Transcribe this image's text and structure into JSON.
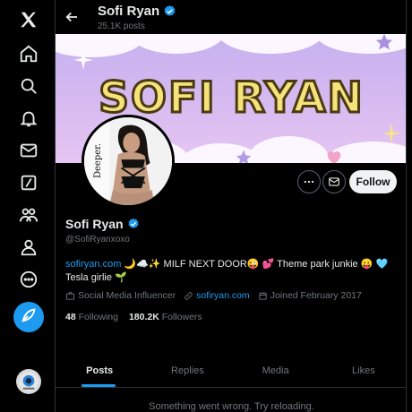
{
  "profile": {
    "name": "Sofi Ryan",
    "post_count": "25.1K posts",
    "handle": "@SofiRyanxoxo",
    "banner_text": "SOFI RYAN",
    "avatar_caption": "Deeper.",
    "bio_link": "sofiryan.com",
    "bio_text": " 🌙☁️✨ MILF NEXT DOOR😜 💕 Theme park junkie 😛 🩵 Tesla girlie 🌱",
    "category": "Social Media Influencer",
    "website": "sofiryan.com",
    "joined": "Joined February 2017",
    "following_count": "48",
    "following_label": "Following",
    "followers_count": "180.2K",
    "followers_label": "Followers"
  },
  "actions": {
    "follow_label": "Follow",
    "more_icon": "more-icon",
    "message_icon": "mail-icon"
  },
  "tabs": [
    {
      "label": "Posts",
      "active": true
    },
    {
      "label": "Replies",
      "active": false
    },
    {
      "label": "Media",
      "active": false
    },
    {
      "label": "Likes",
      "active": false
    }
  ],
  "error_message": "Something went wrong. Try reloading.",
  "nav": [
    "x-logo",
    "home-icon",
    "search-icon",
    "bell-icon",
    "mail-icon",
    "grok-icon",
    "communities-icon",
    "profile-icon",
    "more-circle-icon",
    "compose-icon"
  ],
  "colors": {
    "accent": "#1d9bf0",
    "background": "#000000",
    "muted": "#71767b"
  }
}
